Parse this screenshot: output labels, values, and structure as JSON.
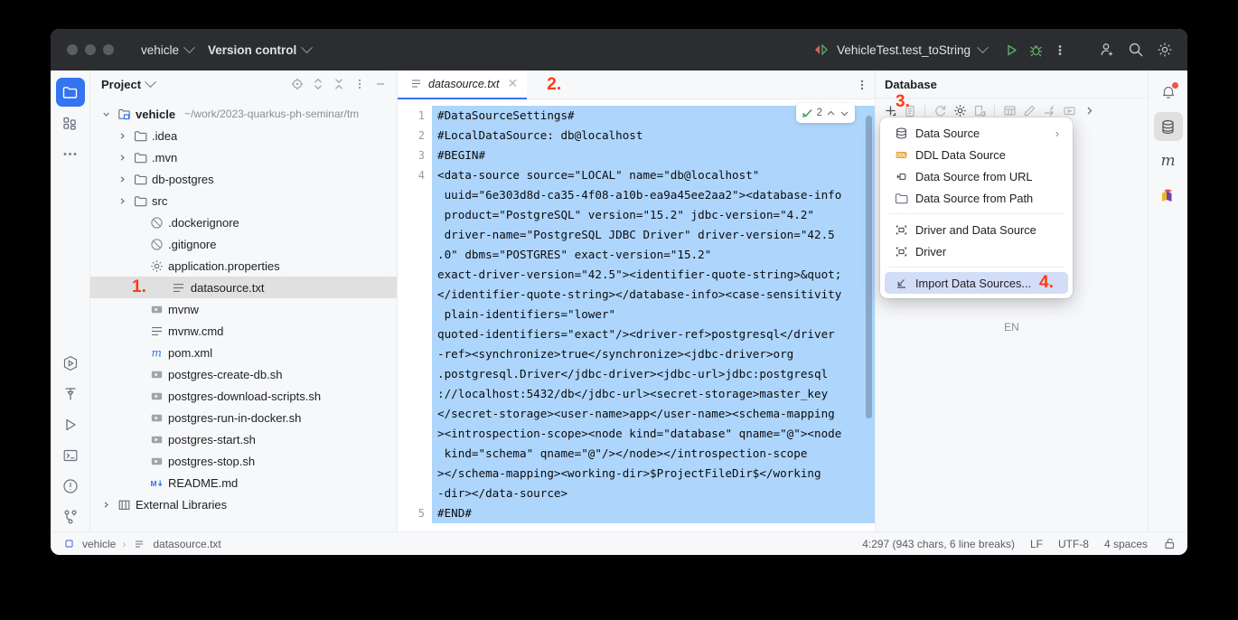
{
  "titlebar": {
    "project_name": "vehicle",
    "vcs_label": "Version control",
    "run_config": "VehicleTest.test_toString",
    "icons": [
      "run-icon",
      "debug-icon",
      "more-actions-icon",
      "add-user-icon",
      "search-icon",
      "settings-icon"
    ]
  },
  "left_stripe": {
    "items": [
      {
        "name": "project-tool-window",
        "icon": "folder-icon",
        "active": true
      },
      {
        "name": "structure-tool-window",
        "icon": "structure-icon",
        "active": false
      },
      {
        "name": "more-tool-windows",
        "icon": "ellipsis-icon",
        "active": false
      },
      {
        "name": "services-tool-window",
        "icon": "services-icon",
        "active": false
      },
      {
        "name": "build-tool-window",
        "icon": "hammer-icon",
        "active": false
      },
      {
        "name": "run-tool-window",
        "icon": "play-icon",
        "active": false
      },
      {
        "name": "terminal-tool-window",
        "icon": "terminal-icon",
        "active": false
      },
      {
        "name": "problems-tool-window",
        "icon": "warning-icon",
        "active": false
      },
      {
        "name": "git-tool-window",
        "icon": "git-branch-icon",
        "active": false
      }
    ]
  },
  "project": {
    "title": "Project",
    "actions": [
      "locate-icon",
      "expand-collapse-icon",
      "collapse-all-icon",
      "options-icon",
      "hide-icon"
    ],
    "tree": [
      {
        "label": "vehicle",
        "path": "~/work/2023-quarkus-ph-seminar/tm",
        "icon": "module-icon",
        "depth": 0,
        "arrow": "down",
        "selected": false,
        "marker": ""
      },
      {
        "label": ".idea",
        "path": "",
        "icon": "folder-icon",
        "depth": 1,
        "arrow": "right",
        "selected": false,
        "marker": ""
      },
      {
        "label": ".mvn",
        "path": "",
        "icon": "folder-icon",
        "depth": 1,
        "arrow": "right",
        "selected": false,
        "marker": ""
      },
      {
        "label": "db-postgres",
        "path": "",
        "icon": "folder-icon",
        "depth": 1,
        "arrow": "right",
        "selected": false,
        "marker": ""
      },
      {
        "label": "src",
        "path": "",
        "icon": "folder-icon",
        "depth": 1,
        "arrow": "right",
        "selected": false,
        "marker": ""
      },
      {
        "label": ".dockerignore",
        "path": "",
        "icon": "ignore-icon",
        "depth": 2,
        "arrow": "none",
        "selected": false,
        "marker": ""
      },
      {
        "label": ".gitignore",
        "path": "",
        "icon": "ignore-icon",
        "depth": 2,
        "arrow": "none",
        "selected": false,
        "marker": ""
      },
      {
        "label": "application.properties",
        "path": "",
        "icon": "properties-icon",
        "depth": 2,
        "arrow": "none",
        "selected": false,
        "marker": ""
      },
      {
        "label": "datasource.txt",
        "path": "",
        "icon": "text-file-icon",
        "depth": 2,
        "arrow": "none",
        "selected": true,
        "marker": "1."
      },
      {
        "label": "mvnw",
        "path": "",
        "icon": "shell-script-icon",
        "depth": 2,
        "arrow": "none",
        "selected": false,
        "marker": ""
      },
      {
        "label": "mvnw.cmd",
        "path": "",
        "icon": "text-file-icon",
        "depth": 2,
        "arrow": "none",
        "selected": false,
        "marker": ""
      },
      {
        "label": "pom.xml",
        "path": "",
        "icon": "maven-icon",
        "depth": 2,
        "arrow": "none",
        "selected": false,
        "marker": ""
      },
      {
        "label": "postgres-create-db.sh",
        "path": "",
        "icon": "shell-script-icon",
        "depth": 2,
        "arrow": "none",
        "selected": false,
        "marker": ""
      },
      {
        "label": "postgres-download-scripts.sh",
        "path": "",
        "icon": "shell-script-icon",
        "depth": 2,
        "arrow": "none",
        "selected": false,
        "marker": ""
      },
      {
        "label": "postgres-run-in-docker.sh",
        "path": "",
        "icon": "shell-script-icon",
        "depth": 2,
        "arrow": "none",
        "selected": false,
        "marker": ""
      },
      {
        "label": "postgres-start.sh",
        "path": "",
        "icon": "shell-script-icon",
        "depth": 2,
        "arrow": "none",
        "selected": false,
        "marker": ""
      },
      {
        "label": "postgres-stop.sh",
        "path": "",
        "icon": "shell-script-icon",
        "depth": 2,
        "arrow": "none",
        "selected": false,
        "marker": ""
      },
      {
        "label": "README.md",
        "path": "",
        "icon": "markdown-icon",
        "depth": 2,
        "arrow": "none",
        "selected": false,
        "marker": ""
      },
      {
        "label": "External Libraries",
        "path": "",
        "icon": "library-icon",
        "depth": 0,
        "arrow": "right",
        "selected": false,
        "marker": ""
      }
    ]
  },
  "editor": {
    "tab_label": "datasource.txt",
    "tab_marker": "2.",
    "inspection_count": "2",
    "gutter": [
      "1",
      "2",
      "3",
      "4",
      "",
      "",
      "",
      "",
      "",
      "",
      "",
      "",
      "",
      "",
      "",
      "",
      "",
      "",
      "",
      "",
      "5"
    ],
    "lines": [
      "#DataSourceSettings#",
      "#LocalDataSource: db@localhost",
      "#BEGIN#",
      "<data-source source=\"LOCAL\" name=\"db@localhost\"",
      " uuid=\"6e303d8d-ca35-4f08-a10b-ea9a45ee2aa2\"><database-info",
      " product=\"PostgreSQL\" version=\"15.2\" jdbc-version=\"4.2\"",
      " driver-name=\"PostgreSQL JDBC Driver\" driver-version=\"42.5",
      ".0\" dbms=\"POSTGRES\" exact-version=\"15.2\"",
      "exact-driver-version=\"42.5\"><identifier-quote-string>&quot;",
      "</identifier-quote-string></database-info><case-sensitivity",
      " plain-identifiers=\"lower\"",
      "quoted-identifiers=\"exact\"/><driver-ref>postgresql</driver",
      "-ref><synchronize>true</synchronize><jdbc-driver>org",
      ".postgresql.Driver</jdbc-driver><jdbc-url>jdbc:postgresql",
      "://localhost:5432/db</jdbc-url><secret-storage>master_key",
      "</secret-storage><user-name>app</user-name><schema-mapping",
      "><introspection-scope><node kind=\"database\" qname=\"@\"><node",
      " kind=\"schema\" qname=\"@\"/></node></introspection-scope",
      "></schema-mapping><working-dir>$ProjectFileDir$</working",
      "-dir></data-source>",
      "#END#"
    ]
  },
  "database": {
    "title": "Database",
    "marker": "3.",
    "toolbar": [
      "add-icon",
      "duplicate-icon",
      "refresh-icon",
      "settings-icon",
      "new-query-console-icon",
      "table-icon",
      "edit-icon",
      "jump-to-icon",
      "run-icon",
      "expand-icon"
    ],
    "background_text": "EN",
    "menu": [
      {
        "label": "Data Source",
        "icon": "database-icon",
        "submenu": "›",
        "highlighted": false,
        "marker": ""
      },
      {
        "label": "DDL Data Source",
        "icon": "ddl-icon",
        "submenu": "",
        "highlighted": false,
        "marker": ""
      },
      {
        "label": "Data Source from URL",
        "icon": "url-icon",
        "submenu": "",
        "highlighted": false,
        "marker": ""
      },
      {
        "label": "Data Source from Path",
        "icon": "folder-icon",
        "submenu": "",
        "highlighted": false,
        "marker": ""
      },
      {
        "separator": true
      },
      {
        "label": "Driver and Data Source",
        "icon": "driver-icon",
        "submenu": "",
        "highlighted": false,
        "marker": ""
      },
      {
        "label": "Driver",
        "icon": "driver-icon",
        "submenu": "",
        "highlighted": false,
        "marker": ""
      },
      {
        "separator": true
      },
      {
        "label": "Import Data Sources...",
        "icon": "import-icon",
        "submenu": "",
        "highlighted": true,
        "marker": "4."
      }
    ]
  },
  "right_stripe": {
    "items": [
      {
        "name": "notifications-tool-window",
        "icon": "bell-icon",
        "active": false,
        "badge": true
      },
      {
        "name": "database-tool-window",
        "icon": "database-icon",
        "active": true,
        "badge": false
      },
      {
        "name": "maven-tool-window",
        "icon": "maven-icon",
        "active": false,
        "badge": false
      },
      {
        "name": "bookmarks-tool-window",
        "icon": "quarkus-icon",
        "active": false,
        "badge": false
      }
    ]
  },
  "status_bar": {
    "breadcrumb_project": "vehicle",
    "breadcrumb_file": "datasource.txt",
    "caret": "4:297 (943 chars, 6 line breaks)",
    "line_separator": "LF",
    "encoding": "UTF-8",
    "indent": "4 spaces",
    "lock_icon": "unlocked-icon"
  },
  "colors": {
    "accent": "#3574f0",
    "selection": "#aed5fc",
    "marker_red": "#ff3b14",
    "titlebar_bg": "#2b2d30",
    "panel_bg": "#f7f8fa"
  }
}
